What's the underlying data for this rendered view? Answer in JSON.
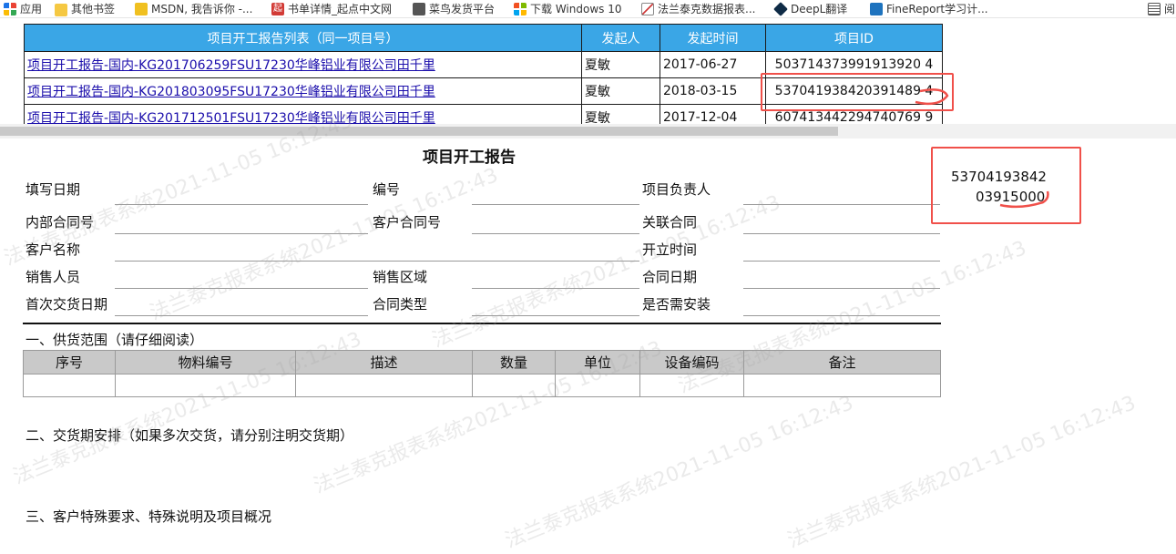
{
  "bookmarks": [
    {
      "label": "应用",
      "icon": "apps-grid-icon"
    },
    {
      "label": "其他书签",
      "icon": "folder-icon"
    },
    {
      "label": "MSDN, 我告诉你 -...",
      "icon": "msdn-icon"
    },
    {
      "label": "书单详情_起点中文网",
      "icon": "qidian-icon"
    },
    {
      "label": "菜鸟发货平台",
      "icon": "globe-icon"
    },
    {
      "label": "下载 Windows 10",
      "icon": "windows-icon"
    },
    {
      "label": "法兰泰克数据报表...",
      "icon": "report-chart-icon"
    },
    {
      "label": "DeepL翻译",
      "icon": "deepl-icon"
    },
    {
      "label": "FineReport学习计...",
      "icon": "finereport-icon"
    },
    {
      "label": "阅",
      "icon": "reading-list-icon"
    }
  ],
  "list_table": {
    "headers": [
      "项目开工报告列表（同一项目号）",
      "发起人",
      "发起时间",
      "项目ID"
    ],
    "rows": [
      {
        "title": "项目开工报告-国内-KG201706259FSU17230华峰铝业有限公司田千里",
        "initiator": "夏敏",
        "date": "2017-06-27",
        "id": "503714373991913920 4"
      },
      {
        "title": "项目开工报告-国内-KG201803095FSU17230华峰铝业有限公司田千里",
        "initiator": "夏敏",
        "date": "2018-03-15",
        "id": "537041938420391489 4"
      },
      {
        "title": "项目开工报告-国内-KG201712501FSU17230华峰铝业有限公司田千里",
        "initiator": "夏敏",
        "date": "2017-12-04",
        "id": "607413442294740769 9"
      }
    ]
  },
  "annotation": {
    "note_line1": "53704193842",
    "note_line2": "03915000",
    "accent_color": "#f0504a"
  },
  "report": {
    "title": "项目开工报告",
    "fields": {
      "fill_date": "填写日期",
      "number": "编号",
      "project_lead": "项目负责人",
      "internal_contract": "内部合同号",
      "customer_contract": "客户合同号",
      "related_contract": "关联合同",
      "customer_name": "客户名称",
      "start_time": "开立时间",
      "sales_person": "销售人员",
      "sales_region": "销售区域",
      "contract_date": "合同日期",
      "first_delivery": "首次交货日期",
      "contract_type": "合同类型",
      "need_install": "是否需安装"
    },
    "section1": "一、供货范围（请仔细阅读）",
    "supply_headers": [
      "序号",
      "物料编号",
      "描述",
      "数量",
      "单位",
      "设备编码",
      "备注"
    ],
    "section2": "二、交货期安排（如果多次交货，请分别注明交货期）",
    "section3": "三、客户特殊要求、特殊说明及项目概况"
  },
  "watermark": "法兰泰克报表系统2021-11-05 16:12:43",
  "colors": {
    "header_blue": "#3aa6e6",
    "link": "#1a0dab",
    "table_header_gray": "#c9c9c9"
  }
}
